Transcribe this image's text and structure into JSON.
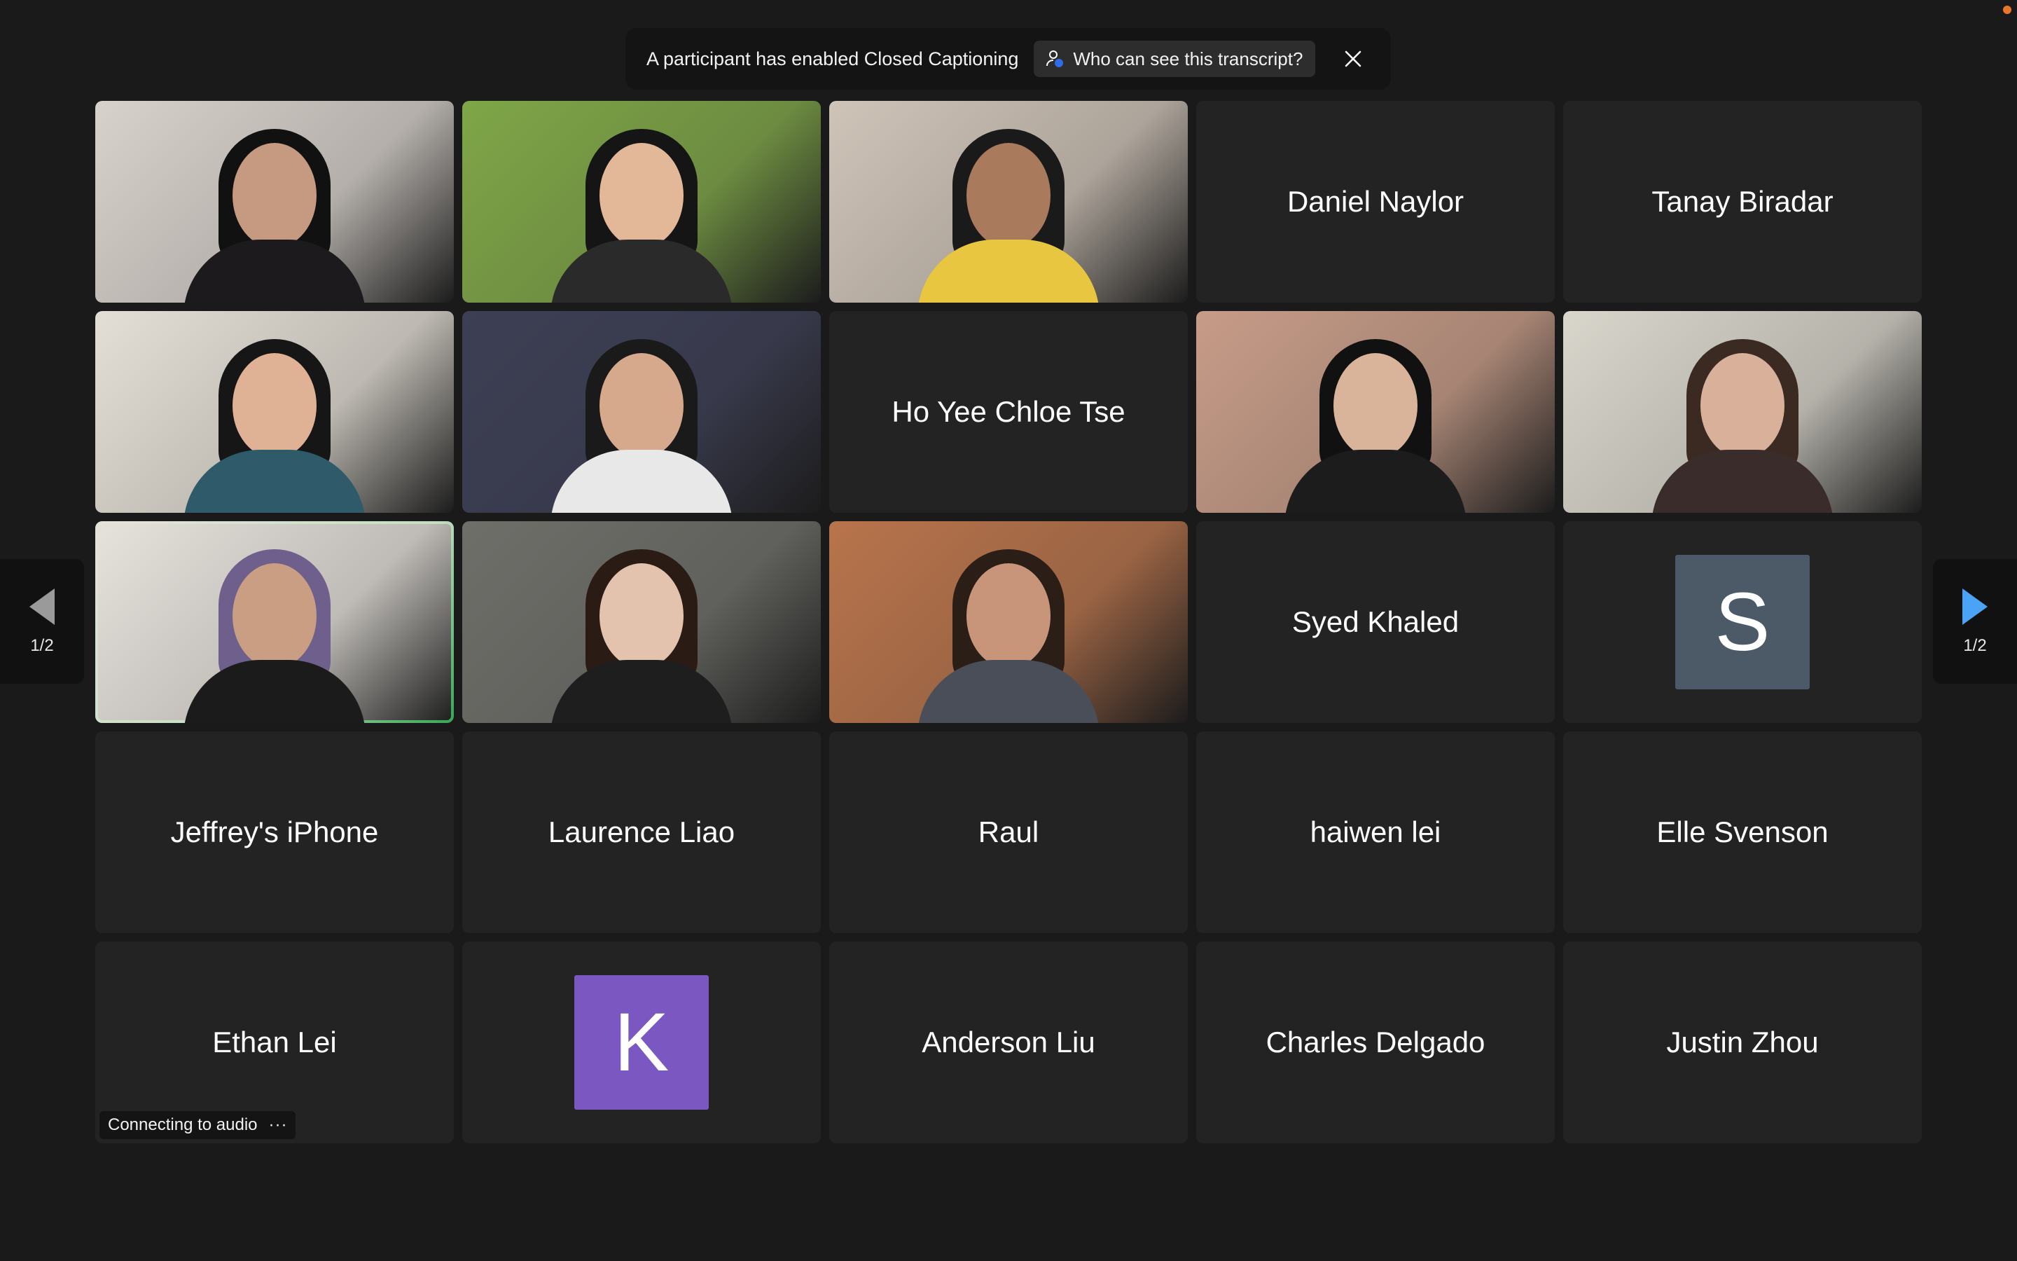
{
  "banner": {
    "message": "A participant has enabled Closed Captioning",
    "who_label": "Who can see this transcript?"
  },
  "pager": {
    "left_page": "1/2",
    "right_page": "1/2"
  },
  "connection": {
    "status": "Connecting to audio",
    "more": "···"
  },
  "tiles": [
    {
      "type": "video"
    },
    {
      "type": "video"
    },
    {
      "type": "video"
    },
    {
      "type": "name",
      "name": "Daniel Naylor"
    },
    {
      "type": "name",
      "name": "Tanay Biradar"
    },
    {
      "type": "video"
    },
    {
      "type": "video"
    },
    {
      "type": "name",
      "name": "Ho Yee Chloe Tse"
    },
    {
      "type": "video"
    },
    {
      "type": "video"
    },
    {
      "type": "video",
      "active": true
    },
    {
      "type": "video"
    },
    {
      "type": "video"
    },
    {
      "type": "name",
      "name": "Syed Khaled"
    },
    {
      "type": "avatar",
      "letter": "S",
      "color": "#4c5a68"
    },
    {
      "type": "name",
      "name": "Jeffrey's iPhone"
    },
    {
      "type": "name",
      "name": "Laurence Liao"
    },
    {
      "type": "name",
      "name": "Raul"
    },
    {
      "type": "name",
      "name": "haiwen lei"
    },
    {
      "type": "name",
      "name": "Elle Svenson"
    },
    {
      "type": "name",
      "name": "Ethan Lei"
    },
    {
      "type": "avatar",
      "letter": "K",
      "color": "#7b57c2"
    },
    {
      "type": "name",
      "name": "Anderson Liu"
    },
    {
      "type": "name",
      "name": "Charles Delgado"
    },
    {
      "type": "name",
      "name": "Justin Zhou"
    }
  ],
  "colors": {
    "background": "#1a1a1a",
    "tile": "#232323",
    "active_speaker": "#45d06a",
    "pager_arrow_active": "#4aa3f5",
    "pager_arrow_inactive": "#9a9a9a"
  }
}
